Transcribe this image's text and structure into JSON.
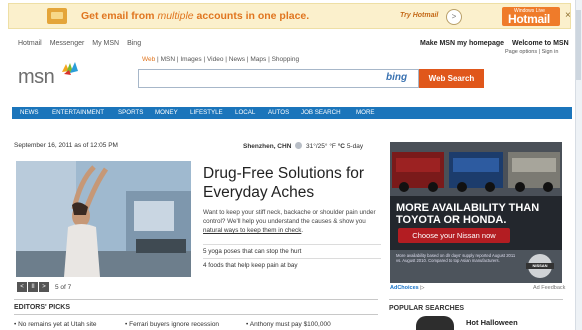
{
  "promo": {
    "headline_prefix": "Get email from ",
    "headline_emph": "multiple",
    "headline_suffix": " accounts in one place.",
    "cta": "Try Hotmail",
    "cta_button": ">",
    "logo_small": "Windows Live",
    "logo_big": "Hotmail",
    "close": "×"
  },
  "header": {
    "links": [
      "Hotmail",
      "Messenger",
      "My MSN",
      "Bing"
    ],
    "homepage_link": "Make MSN my homepage",
    "welcome": "Welcome to MSN",
    "page_options": "Page options | Sign in"
  },
  "logo": {
    "text": "msn"
  },
  "search": {
    "tabs": [
      "Web",
      "MSN",
      "Images",
      "Video",
      "News",
      "Maps",
      "Shopping"
    ],
    "separator": " | ",
    "input_value": "",
    "brand": "bing",
    "button": "Web Search"
  },
  "nav": [
    "NEWS",
    "ENTERTAINMENT",
    "SPORTS",
    "MONEY",
    "LIFESTYLE",
    "LOCAL",
    "AUTOS",
    "JOB SEARCH",
    "MORE"
  ],
  "dateline": "September 16, 2011 as of 12:05 PM",
  "weather": {
    "city": "Shenzhen, CHN",
    "temps": "31°/25°",
    "unit_f": "°F",
    "unit_c": "°C",
    "forecast": "5-day"
  },
  "hero": {
    "title": "Drug-Free Solutions for Everyday Aches",
    "body_pre": "Want to keep your stiff neck, backache or shoulder pain under control? We'll help you understand the causes & show you ",
    "body_link": "natural ways to keep them in check",
    "body_post": ".",
    "links": [
      "5 yoga poses that can stop the hurt",
      "4 foods that help keep pain at bay"
    ],
    "controls": [
      "<",
      "II",
      ">"
    ],
    "counter": "5 of 7"
  },
  "ad": {
    "headline": "MORE AVAILABILITY THAN TOYOTA OR HONDA.",
    "button": "Choose your Nissan now",
    "fine_print": "More availability based on dlr days' supply reported August 2011 vs. August 2010. Compared to top Asian manufacturers.",
    "brand": "NISSAN",
    "choices_label": "AdChoices",
    "feedback": "Ad Feedback"
  },
  "editors_picks": {
    "heading": "EDITORS' PICKS",
    "items": [
      "No remains yet at Utah site",
      "Ferrari buyers ignore recession",
      "Anthony must pay $100,000"
    ]
  },
  "popular": {
    "heading": "POPULAR SEARCHES",
    "item": "Hot Halloween"
  },
  "colors": {
    "accent_orange": "#e0751f",
    "nav_blue": "#1b75bb",
    "search_button": "#e0571b",
    "ad_red_button": "#b31d22"
  }
}
